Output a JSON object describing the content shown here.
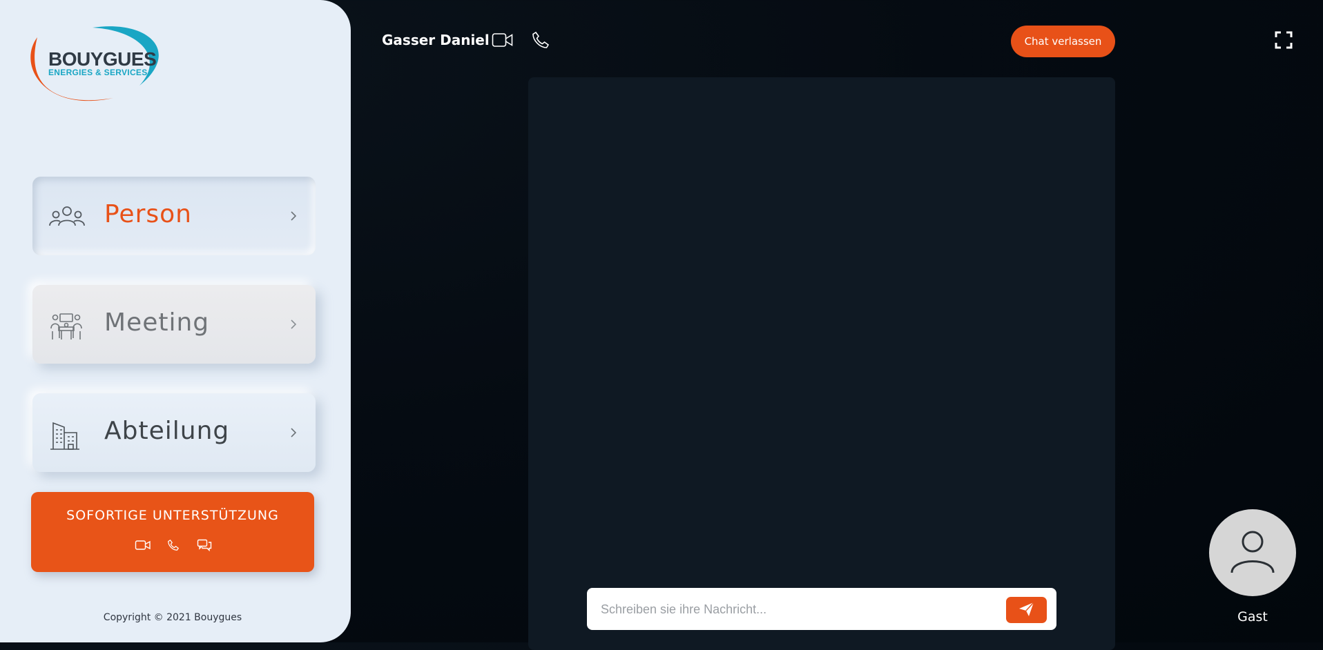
{
  "brand": {
    "name": "BOUYGUES",
    "subtitle": "ENERGIES & SERVICES",
    "colors": {
      "orange": "#e85118",
      "teal": "#1aa6c4",
      "dark": "#2f3a45"
    }
  },
  "sidebar": {
    "items": [
      {
        "label": "Person",
        "icon": "people-group-icon",
        "state": "active"
      },
      {
        "label": "Meeting",
        "icon": "meeting-icon",
        "state": "disabled"
      },
      {
        "label": "Abteilung",
        "icon": "building-icon",
        "state": "default"
      }
    ],
    "support": {
      "title": "SOFORTIGE UNTERSTÜTZUNG",
      "icons": [
        "video-camera-icon",
        "phone-icon",
        "chat-bubbles-icon"
      ]
    },
    "copyright": "Copyright © 2021 Bouygues"
  },
  "header": {
    "caller_name": "Gasser Daniel",
    "icons": [
      "video-camera-icon",
      "phone-icon",
      "fullscreen-icon"
    ],
    "leave_button": "Chat verlassen"
  },
  "chat": {
    "placeholder": "Schreiben sie ihre Nachricht...",
    "send_icon": "send-icon"
  },
  "guest": {
    "label": "Gast",
    "icon": "user-icon"
  }
}
